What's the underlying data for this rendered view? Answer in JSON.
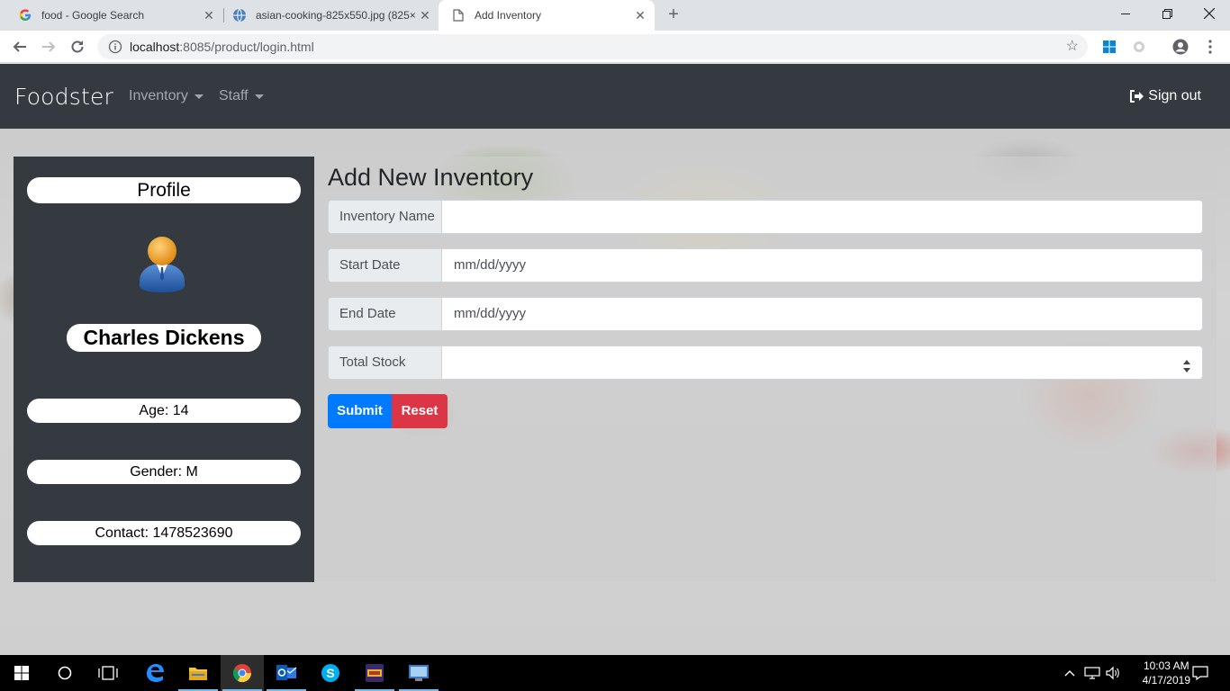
{
  "browser": {
    "tabs": [
      {
        "title": "food - Google Search",
        "favicon": "google-g-icon"
      },
      {
        "title": "asian-cooking-825x550.jpg (825×",
        "favicon": "globe-icon"
      },
      {
        "title": "Add Inventory",
        "favicon": "document-icon"
      }
    ],
    "active_tab": 2,
    "url_host": "localhost",
    "url_rest": ":8085/product/login.html"
  },
  "navbar": {
    "brand": "Foodster",
    "menus": [
      {
        "label": "Inventory"
      },
      {
        "label": "Staff"
      }
    ],
    "signout_label": "Sign out"
  },
  "profile": {
    "title": "Profile",
    "name": "Charles Dickens",
    "age": "Age: 14",
    "gender": "Gender: M",
    "contact": "Contact: 1478523690"
  },
  "form": {
    "title": "Add New Inventory",
    "fields": [
      {
        "label": "Inventory Name",
        "value": ""
      },
      {
        "label": "Start Date",
        "value": "mm/dd/yyyy"
      },
      {
        "label": "End Date",
        "value": "mm/dd/yyyy"
      },
      {
        "label": "Total Stock",
        "value": ""
      }
    ],
    "submit_label": "Submit",
    "reset_label": "Reset"
  },
  "taskbar": {
    "time": "10:03 AM",
    "date": "4/17/2019"
  },
  "colors": {
    "navbar_bg": "#343a40",
    "submit": "#007bff",
    "reset": "#dc3545"
  }
}
